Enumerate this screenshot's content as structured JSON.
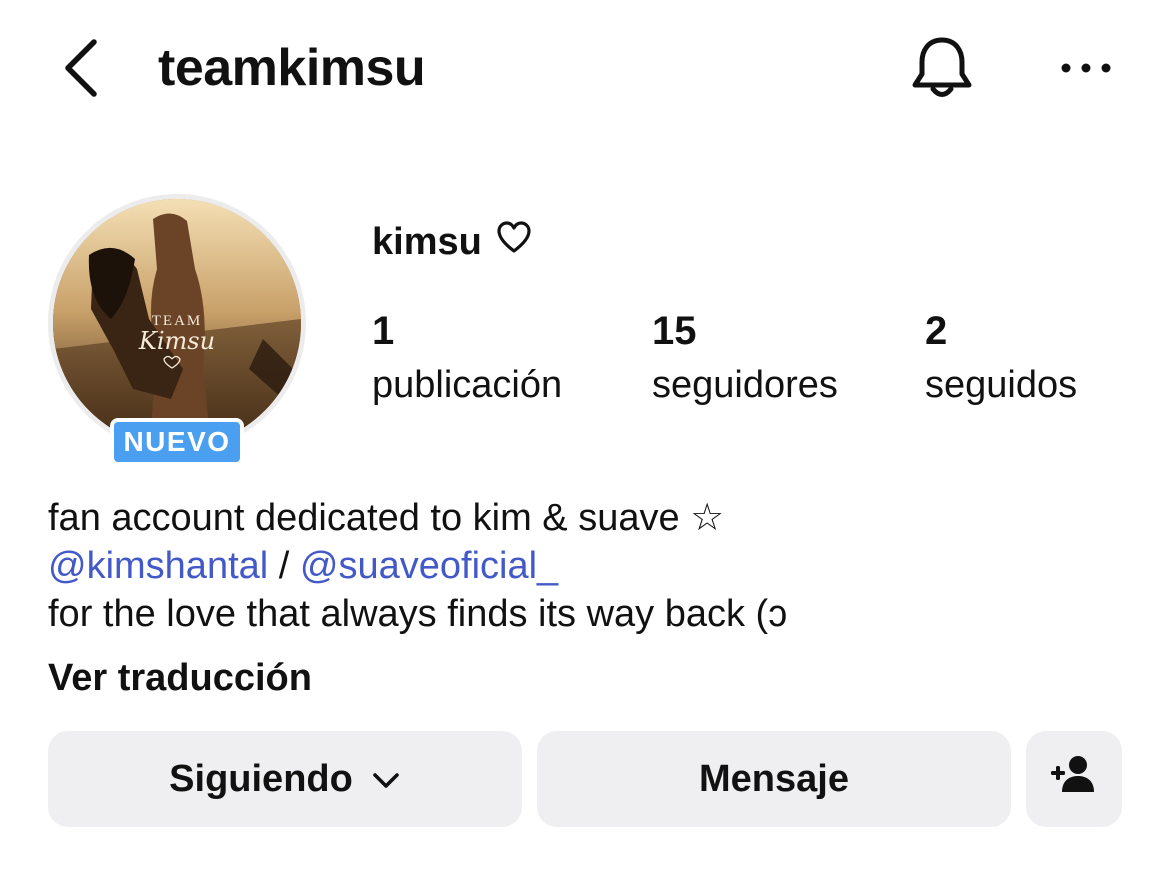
{
  "header": {
    "username": "teamkimsu",
    "icons": [
      "back-chevron-icon",
      "bell-icon",
      "more-horizontal-icon"
    ]
  },
  "profile": {
    "display_name": "kimsu",
    "name_icon": "heart-outline-icon",
    "badge": "NUEVO",
    "avatar_text": {
      "line1": "TEAM",
      "line2": "Kimsu"
    },
    "stats": [
      {
        "value": "1",
        "label": "publicación"
      },
      {
        "value": "15",
        "label": "seguidores"
      },
      {
        "value": "2",
        "label": "seguidos"
      }
    ]
  },
  "bio": {
    "line1": "fan account dedicated to kim & suave ☆",
    "mention1": "@kimshantal",
    "separator": " / ",
    "mention2": "@suaveoficial_",
    "line3": "for the love that always finds its way back ",
    "line3_glyph": "(ɔ",
    "translate": "Ver traducción"
  },
  "actions": {
    "following": "Siguiendo",
    "message": "Mensaje",
    "suggest_icon": "add-person-icon"
  },
  "colors": {
    "badge": "#4a9ff0",
    "mention": "#4459c8",
    "button_bg": "#efeff1"
  }
}
